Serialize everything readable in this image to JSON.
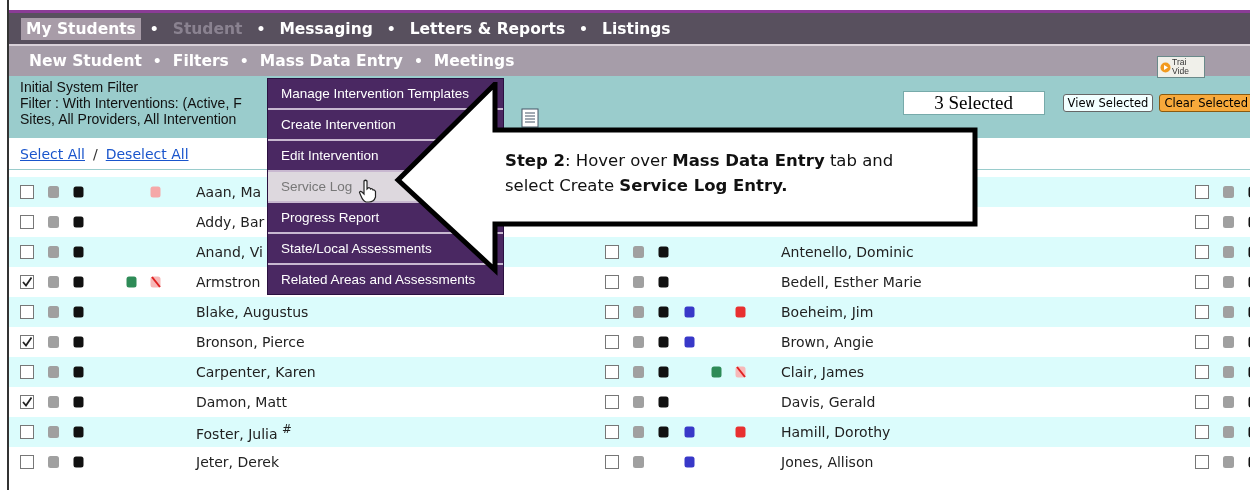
{
  "nav": {
    "separator": "•",
    "tabs": [
      {
        "label": "My Students",
        "selected": true,
        "disabled": false
      },
      {
        "label": "Student",
        "selected": false,
        "disabled": true
      },
      {
        "label": "Messaging",
        "selected": false,
        "disabled": false
      },
      {
        "label": "Letters & Reports",
        "selected": false,
        "disabled": false
      },
      {
        "label": "Listings",
        "selected": false,
        "disabled": false
      }
    ]
  },
  "subnav": {
    "items": [
      "New Student",
      "Filters",
      "Mass Data Entry",
      "Meetings"
    ]
  },
  "training_video": {
    "label": [
      "Trai",
      "Vide"
    ]
  },
  "filter": {
    "lines": [
      "Initial System Filter",
      "Filter : With Interventions: (Active, F",
      "Sites, All Providers, All Intervention"
    ],
    "selected_count": "3 Selected",
    "buttons": [
      {
        "label": "View Selected",
        "kind": "plain"
      },
      {
        "label": "Clear Selected",
        "kind": "warning"
      }
    ]
  },
  "selection_links": {
    "select_all": "Select All",
    "divider": "/",
    "deselect_all": "Deselect All"
  },
  "dropdown": {
    "items": [
      {
        "label": "Manage Intervention Templates",
        "selected": false
      },
      {
        "label": "Create Intervention",
        "selected": false
      },
      {
        "label": "Edit Intervention",
        "selected": false
      },
      {
        "label": "Service Log",
        "selected": true
      },
      {
        "label": "Progress Report",
        "selected": false
      },
      {
        "label": "State/Local Assessments",
        "selected": false
      },
      {
        "label": "Related Areas and Assessments",
        "selected": false
      }
    ]
  },
  "callout": {
    "text": "**Step 2**: Hover over **Mass Data Entry** tab and select Create **Service Log Entry.**"
  },
  "rows": [
    {
      "left": {
        "checked": false,
        "markers": [
          {
            "kind": "dark"
          },
          {
            "kind": "pink"
          }
        ],
        "name": "Aaan, Ma"
      },
      "right": {
        "checked": false,
        "markers": [
          {
            "kind": "dark"
          }
        ]
      }
    },
    {
      "left": {
        "checked": false,
        "markers": [
          {
            "kind": "dark"
          }
        ],
        "name": "Addy, Bar"
      },
      "right": {
        "checked": false,
        "markers": [
          {
            "kind": "dark"
          }
        ]
      }
    },
    {
      "left": {
        "checked": false,
        "markers": [
          {
            "kind": "dark"
          }
        ],
        "name": "Anand, Vi"
      },
      "middle": {
        "checked": false,
        "markers": [
          {
            "kind": "dark"
          }
        ],
        "name": "Antenello, Dominic"
      },
      "right": {
        "checked": false,
        "markers": [
          {
            "kind": "dark"
          }
        ]
      }
    },
    {
      "left": {
        "checked": true,
        "markers": [
          {
            "kind": "dark"
          },
          {
            "kind": "green"
          },
          {
            "kind": "pink-slash"
          }
        ],
        "name": "Armstron"
      },
      "middle": {
        "checked": false,
        "markers": [
          {
            "kind": "dark"
          }
        ],
        "name": "Bedell, Esther Marie"
      },
      "right": {
        "checked": false,
        "markers": [
          {
            "kind": "dark"
          }
        ]
      }
    },
    {
      "left": {
        "checked": false,
        "markers": [
          {
            "kind": "dark"
          }
        ],
        "name": "Blake, Augustus"
      },
      "middle": {
        "checked": false,
        "markers": [
          {
            "kind": "dark"
          },
          {
            "kind": "blue"
          },
          {
            "kind": "red"
          }
        ],
        "name": "Boeheim, Jim"
      },
      "right": {
        "checked": false,
        "markers": [
          {
            "kind": "dark"
          }
        ]
      }
    },
    {
      "left": {
        "checked": true,
        "markers": [
          {
            "kind": "dark"
          }
        ],
        "name": "Bronson, Pierce"
      },
      "middle": {
        "checked": false,
        "markers": [
          {
            "kind": "dark"
          },
          {
            "kind": "blue"
          }
        ],
        "name": "Brown, Angie"
      },
      "right": {
        "checked": false,
        "markers": [
          {
            "kind": "dark"
          }
        ]
      }
    },
    {
      "left": {
        "checked": false,
        "markers": [
          {
            "kind": "dark"
          }
        ],
        "name": "Carpenter, Karen"
      },
      "middle": {
        "checked": false,
        "markers": [
          {
            "kind": "dark"
          },
          {
            "kind": "green"
          },
          {
            "kind": "pink-slash"
          }
        ],
        "name": "Clair, James"
      },
      "right": {
        "checked": false,
        "markers": [
          {
            "kind": "dark"
          }
        ]
      }
    },
    {
      "left": {
        "checked": true,
        "markers": [
          {
            "kind": "dark"
          }
        ],
        "name": "Damon, Matt"
      },
      "middle": {
        "checked": false,
        "markers": [
          {
            "kind": "dark"
          }
        ],
        "name": "Davis, Gerald"
      },
      "right": {
        "checked": false,
        "markers": [
          {
            "kind": "dark"
          }
        ]
      }
    },
    {
      "left": {
        "checked": false,
        "markers": [
          {
            "kind": "dark"
          }
        ],
        "name": "Foster, Julia $^{#}$"
      },
      "middle": {
        "checked": false,
        "markers": [
          {
            "kind": "dark"
          },
          {
            "kind": "blue"
          },
          {
            "kind": "red"
          }
        ],
        "name": "Hamill, Dorothy"
      },
      "right": {
        "checked": false,
        "markers": [
          {
            "kind": "dark"
          }
        ]
      }
    },
    {
      "left": {
        "checked": false,
        "markers": [
          {
            "kind": "dark"
          }
        ],
        "name": "Jeter, Derek"
      },
      "middle": {
        "checked": false,
        "markers": [
          {
            "kind": "blue"
          }
        ],
        "name": "Jones, Allison"
      },
      "right": {
        "checked": false,
        "markers": [
          {
            "kind": "dark"
          }
        ]
      }
    }
  ]
}
